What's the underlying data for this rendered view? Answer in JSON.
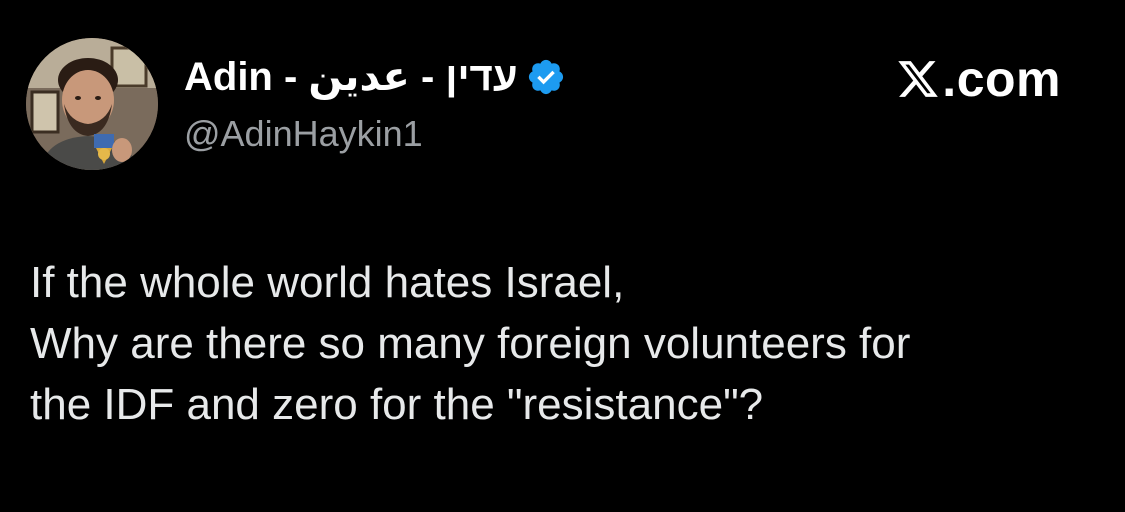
{
  "author": {
    "display_name": "Adin - עדין - عدين",
    "handle": "@AdinHaykin1",
    "verified": true,
    "verified_color": "#1d9bf0"
  },
  "brand": {
    "text": ".com",
    "icon": "x-logo-icon"
  },
  "tweet": {
    "lines": [
      "If the whole world hates Israel,",
      "Why are there so many foreign volunteers for",
      "the IDF and zero for the \"resistance\"?"
    ]
  },
  "colors": {
    "background": "#000000",
    "text": "#e7e9ea",
    "secondary_text": "#9b9fa3"
  }
}
